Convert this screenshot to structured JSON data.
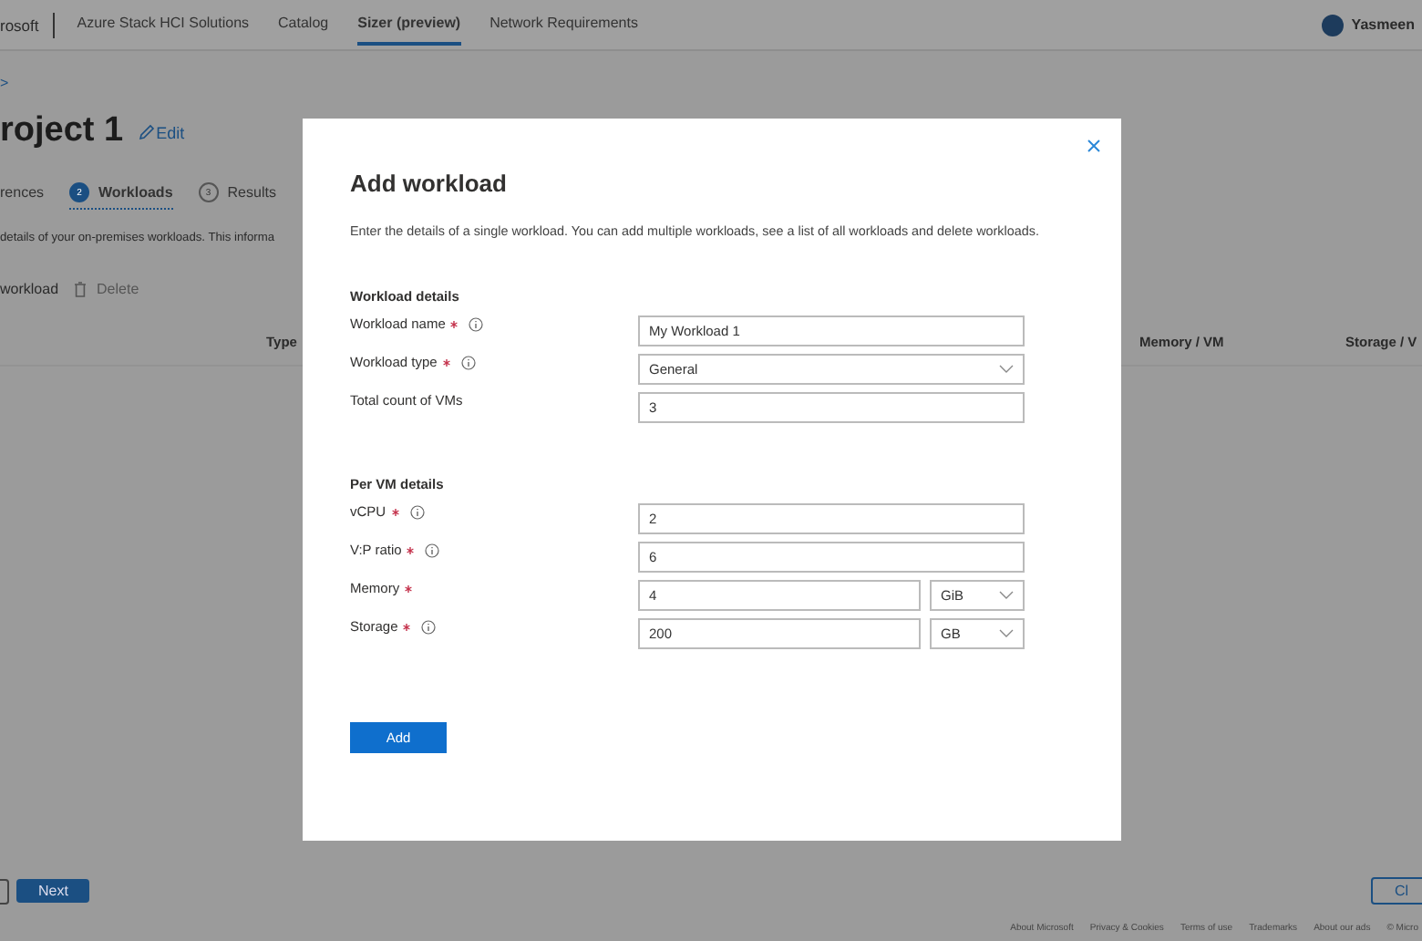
{
  "nav": {
    "brand": "rosoft",
    "links": [
      {
        "label": "Azure Stack HCI Solutions",
        "selected": false
      },
      {
        "label": "Catalog",
        "selected": false
      },
      {
        "label": "Sizer (preview)",
        "selected": true
      },
      {
        "label": "Network Requirements",
        "selected": false
      }
    ],
    "user_name": "Yasmeen"
  },
  "breadcrumb": ">",
  "page": {
    "title": "roject 1",
    "edit_link": "Edit"
  },
  "steps": [
    {
      "label": "rences",
      "selected": false
    },
    {
      "number": "2",
      "label": "Workloads",
      "selected": true
    },
    {
      "number": "3",
      "label": "Results",
      "selected": false
    }
  ],
  "description": "details of your on-premises workloads. This informa",
  "toolbar": {
    "add_label": "workload",
    "delete": {
      "label": "Delete",
      "disabled": true
    }
  },
  "table": {
    "columns": [
      "Type",
      "Memory / VM",
      "Storage / V"
    ]
  },
  "footer": {
    "buttons": [
      {
        "label": "Next",
        "kind": "primary"
      },
      {
        "label": "Cl",
        "kind": "secondary"
      }
    ],
    "links": [
      "About Microsoft",
      "Privacy & Cookies",
      "Terms of use",
      "Trademarks",
      "About our ads",
      "© Micro"
    ]
  },
  "modal": {
    "title": "Add workload",
    "description": "Enter the details of a single workload. You can add multiple workloads, see a list of all workloads and delete workloads.",
    "sections": [
      {
        "heading": "Workload details",
        "fields": [
          {
            "label": "Workload name",
            "required": true,
            "info": true,
            "kind": "text",
            "value": "My Workload 1"
          },
          {
            "label": "Workload type",
            "required": true,
            "info": true,
            "kind": "select",
            "value": "General"
          },
          {
            "label": "Total count of VMs",
            "required": false,
            "info": false,
            "kind": "text",
            "value": "3"
          }
        ]
      },
      {
        "heading": "Per VM details",
        "fields": [
          {
            "label": "vCPU",
            "required": true,
            "info": true,
            "kind": "text",
            "value": "2"
          },
          {
            "label": "V:P ratio",
            "required": true,
            "info": true,
            "kind": "text",
            "value": "6"
          },
          {
            "label": "Memory",
            "required": true,
            "info": false,
            "kind": "unit",
            "value": "4",
            "unit": "GiB"
          },
          {
            "label": "Storage",
            "required": true,
            "info": true,
            "kind": "unit",
            "value": "200",
            "unit": "GB"
          }
        ]
      }
    ],
    "add_button": "Add"
  }
}
